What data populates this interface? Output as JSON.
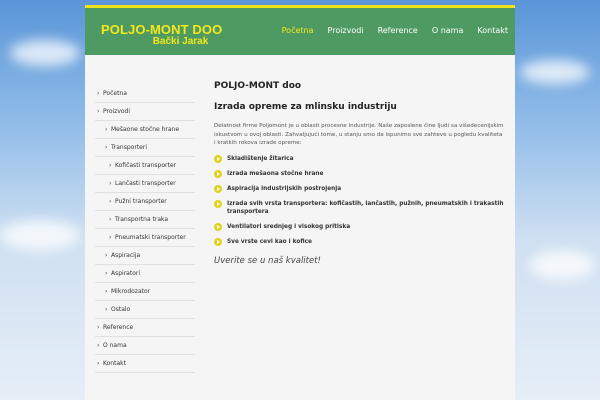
{
  "logo": {
    "line1": "POLJO-MONT DOO",
    "line2": "Bački Jarak"
  },
  "topnav": [
    {
      "label": "Početna",
      "active": true
    },
    {
      "label": "Proizvodi",
      "active": false
    },
    {
      "label": "Reference",
      "active": false
    },
    {
      "label": "O nama",
      "active": false
    },
    {
      "label": "Kontakt",
      "active": false
    }
  ],
  "sidebar": {
    "items": [
      {
        "label": "Početna",
        "level": 1
      },
      {
        "label": "Proizvodi",
        "level": 1
      },
      {
        "label": "Mešaone stočne hrane",
        "level": 2
      },
      {
        "label": "Transporteri",
        "level": 2
      },
      {
        "label": "Kofičasti transporter",
        "level": 3
      },
      {
        "label": "Lančasti transporter",
        "level": 3
      },
      {
        "label": "Pužni transporter",
        "level": 3
      },
      {
        "label": "Transportna traka",
        "level": 3
      },
      {
        "label": "Pneumatski transporter",
        "level": 3
      },
      {
        "label": "Aspiracija",
        "level": 2
      },
      {
        "label": "Aspiratori",
        "level": 2
      },
      {
        "label": "Mikrodozator",
        "level": 2
      },
      {
        "label": "Ostalo",
        "level": 2
      },
      {
        "label": "Reference",
        "level": 1
      },
      {
        "label": "O nama",
        "level": 1
      },
      {
        "label": "Kontakt",
        "level": 1
      }
    ]
  },
  "content": {
    "company": "POLJO-MONT doo",
    "headline": "Izrada opreme za mlinsku industriju",
    "intro": "Delatnost firme Poljomont je u oblasti procesne industrije. Naše zaposlene čine ljudi sa višedecenijskim iskustvom u ovoj oblasti. Zahvaljujući tome, u stanju smo da ispunimo sve zahteve u pogledu kvaliteta i kratkih rokova izrade opreme:",
    "bullets": [
      "Skladištenje žitarica",
      "Izrada mešaona stočne hrane",
      "Aspiracija industrijskih postrojenja",
      "Izrada svih vrsta transportera: kofičastih, lančastih, pužnih, pneumatskih i trakastih transportera",
      "Ventilatori srednjeg i visokog pritiska",
      "Sve vrste cevi kao i kofice"
    ],
    "tagline": "Uverite se u naš kvalitet!"
  },
  "colors": {
    "header": "#4f9a62",
    "accent": "#f3e81c",
    "bullet": "#e3d21b"
  }
}
